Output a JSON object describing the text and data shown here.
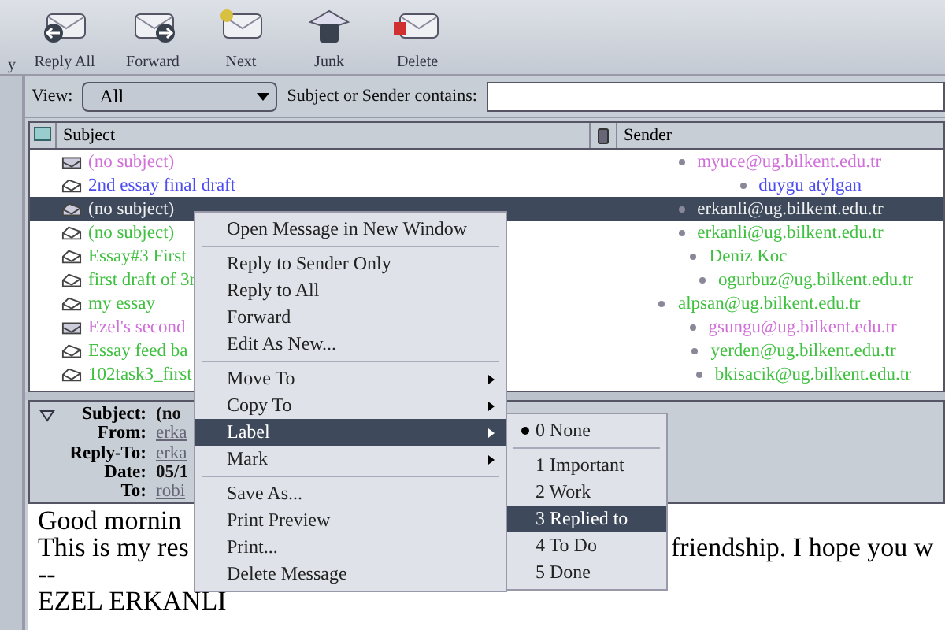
{
  "toolbar": [
    {
      "label": "y",
      "kind": "reply"
    },
    {
      "label": "Reply All",
      "kind": "replyall"
    },
    {
      "label": "Forward",
      "kind": "forward"
    },
    {
      "label": "Next",
      "kind": "next"
    },
    {
      "label": "Junk",
      "kind": "junk"
    },
    {
      "label": "Delete",
      "kind": "delete"
    }
  ],
  "view": {
    "label": "View:",
    "value": "All",
    "search_label": "Subject or Sender contains:"
  },
  "table": {
    "columns": [
      "Subject",
      "Sender"
    ],
    "rows": [
      {
        "subject": "(no subject)",
        "sender": "myuce@ug.bilkent.edu.tr",
        "color": "#d070d8",
        "read": false,
        "selected": false
      },
      {
        "subject": "2nd essay final draft",
        "sender": "duygu atýlgan",
        "color": "#4c4cf0",
        "read": true,
        "selected": false
      },
      {
        "subject": "(no subject)",
        "sender": "erkanli@ug.bilkent.edu.tr",
        "read": true,
        "selected": true
      },
      {
        "subject": "(no subject)",
        "sender": "erkanli@ug.bilkent.edu.tr",
        "color": "#40c040",
        "read": true,
        "selected": false
      },
      {
        "subject": "Essay#3 First",
        "sender": "Deniz Koc",
        "color": "#40c040",
        "read": true,
        "selected": false
      },
      {
        "subject": "first draft of 3r",
        "sender": "ogurbuz@ug.bilkent.edu.tr",
        "color": "#40c040",
        "read": true,
        "selected": false
      },
      {
        "subject": "my essay",
        "sender": "alpsan@ug.bilkent.edu.tr",
        "color": "#40c040",
        "read": true,
        "selected": false
      },
      {
        "subject": "Ezel's second",
        "sender": "gsungu@ug.bilkent.edu.tr",
        "color": "#d070d8",
        "read": false,
        "selected": false
      },
      {
        "subject": "Essay feed ba",
        "sender": "yerden@ug.bilkent.edu.tr",
        "color": "#40c040",
        "read": true,
        "selected": false
      },
      {
        "subject": "102task3_first",
        "sender": "bkisacik@ug.bilkent.edu.tr",
        "color": "#40c040",
        "read": true,
        "selected": false
      }
    ]
  },
  "headers": [
    {
      "label": "Subject:",
      "value": "(no",
      "kind": "plain"
    },
    {
      "label": "From:",
      "value": "erka",
      "kind": "link"
    },
    {
      "label": "Reply-To:",
      "value": "erka",
      "kind": "link"
    },
    {
      "label": "Date:",
      "value": "05/1",
      "kind": "plain"
    },
    {
      "label": "To:",
      "value": "robi",
      "kind": "link"
    }
  ],
  "body": {
    "lines": [
      "Good mornin",
      "This is my res",
      "--",
      "EZEL ERKANLI"
    ],
    "tail": "friendship. I hope you w"
  },
  "context_menu": [
    {
      "kind": "item",
      "label": "Open Message in New Window",
      "selected": false
    },
    {
      "kind": "separator"
    },
    {
      "kind": "item",
      "label": "Reply to Sender Only",
      "selected": false
    },
    {
      "kind": "item",
      "label": "Reply to All",
      "selected": false
    },
    {
      "kind": "item",
      "label": "Forward",
      "selected": false
    },
    {
      "kind": "item",
      "label": "Edit As New...",
      "selected": false
    },
    {
      "kind": "separator"
    },
    {
      "kind": "submenu",
      "label": "Move To",
      "selected": false
    },
    {
      "kind": "submenu",
      "label": "Copy To",
      "selected": false
    },
    {
      "kind": "submenu",
      "label": "Label",
      "selected": true
    },
    {
      "kind": "submenu",
      "label": "Mark",
      "selected": false
    },
    {
      "kind": "separator"
    },
    {
      "kind": "item",
      "label": "Save As...",
      "selected": false
    },
    {
      "kind": "item",
      "label": "Print Preview",
      "selected": false
    },
    {
      "kind": "item",
      "label": "Print...",
      "selected": false
    },
    {
      "kind": "item",
      "label": "Delete Message",
      "selected": false
    }
  ],
  "label_submenu": [
    {
      "kind": "radio",
      "label": "0 None",
      "checked": true,
      "selected": false
    },
    {
      "kind": "separator"
    },
    {
      "kind": "radio",
      "label": "1 Important",
      "checked": false,
      "selected": false
    },
    {
      "kind": "radio",
      "label": "2 Work",
      "checked": false,
      "selected": false
    },
    {
      "kind": "radio",
      "label": "3 Replied to",
      "checked": false,
      "selected": true
    },
    {
      "kind": "radio",
      "label": "4 To Do",
      "checked": false,
      "selected": false
    },
    {
      "kind": "radio",
      "label": "5 Done",
      "checked": false,
      "selected": false
    }
  ]
}
